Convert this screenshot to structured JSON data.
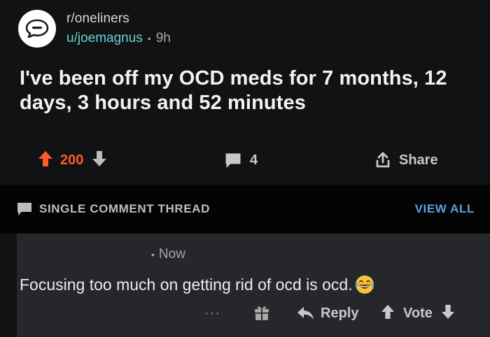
{
  "post": {
    "subreddit": "r/oneliners",
    "username": "u/joemagnus",
    "separator": "•",
    "age": "9h",
    "title": "I've been off my OCD meds for 7 months, 12 days, 3 hours and 52 minutes"
  },
  "actions": {
    "score": "200",
    "comments": "4",
    "share_label": "Share"
  },
  "thread_bar": {
    "label": "SINGLE COMMENT THREAD",
    "view_all_label": "VIEW ALL"
  },
  "comment": {
    "bullet": "•",
    "time": "Now",
    "text": "Focusing too much on getting rid of ocd is ocd.",
    "more_label": "···",
    "reply_label": "Reply",
    "vote_label": "Vote"
  },
  "colors": {
    "background": "#111214",
    "upvote_active": "#ff5a2c",
    "username": "#6bd0d0",
    "link_blue": "#5b9fe3",
    "comment_bg": "#25272b"
  },
  "icons": {
    "avatar": "speech-bubble-icon",
    "upvote": "upvote-arrow-icon",
    "downvote": "downvote-arrow-icon",
    "comments": "comment-icon",
    "share": "share-icon",
    "thread": "comment-icon",
    "gift": "gift-icon",
    "reply": "reply-arrow-icon",
    "emoji": "laughing-tears-emoji-icon"
  }
}
